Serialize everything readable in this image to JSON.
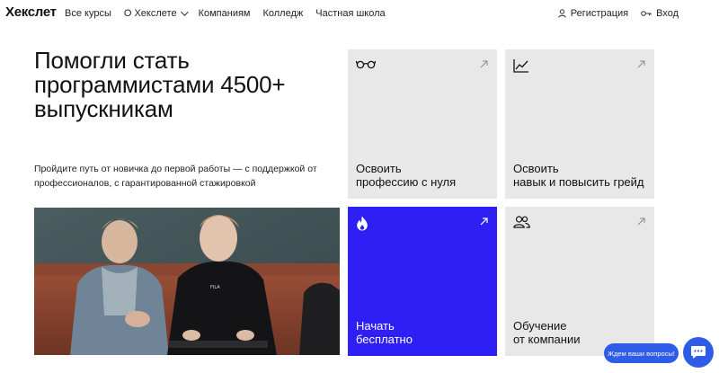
{
  "brand": {
    "logo_text": "Хекслет"
  },
  "nav": {
    "items": [
      {
        "label": "Все курсы"
      },
      {
        "label": "О Хекслете"
      },
      {
        "label": "Компаниям"
      },
      {
        "label": "Колледж"
      },
      {
        "label": "Частная школа"
      }
    ]
  },
  "auth": {
    "register_label": "Регистрация",
    "login_label": "Вход"
  },
  "hero": {
    "title": "Помогли стать программистами 4500+ выпускникам",
    "subtitle": "Пройдите путь от новичка до первой работы — с поддержкой от профессионалов, с гарантированной стажировкой"
  },
  "cards": [
    {
      "line1": "Освоить",
      "line2": "профессию с нуля",
      "icon": "glasses-icon"
    },
    {
      "line1": "Освоить",
      "line2": "навык и повысить грейд",
      "icon": "chart-icon"
    },
    {
      "line1": "Начать",
      "line2": "бесплатно",
      "icon": "flame-icon"
    },
    {
      "line1": "Обучение",
      "line2": "от компании",
      "icon": "users-icon"
    }
  ],
  "chat": {
    "bubble_text": "Ждем ваши вопросы!"
  },
  "colors": {
    "accent_blue": "#2e1ff5",
    "card_gray": "#e8e8e8",
    "chat_blue": "#2e5ce6"
  }
}
